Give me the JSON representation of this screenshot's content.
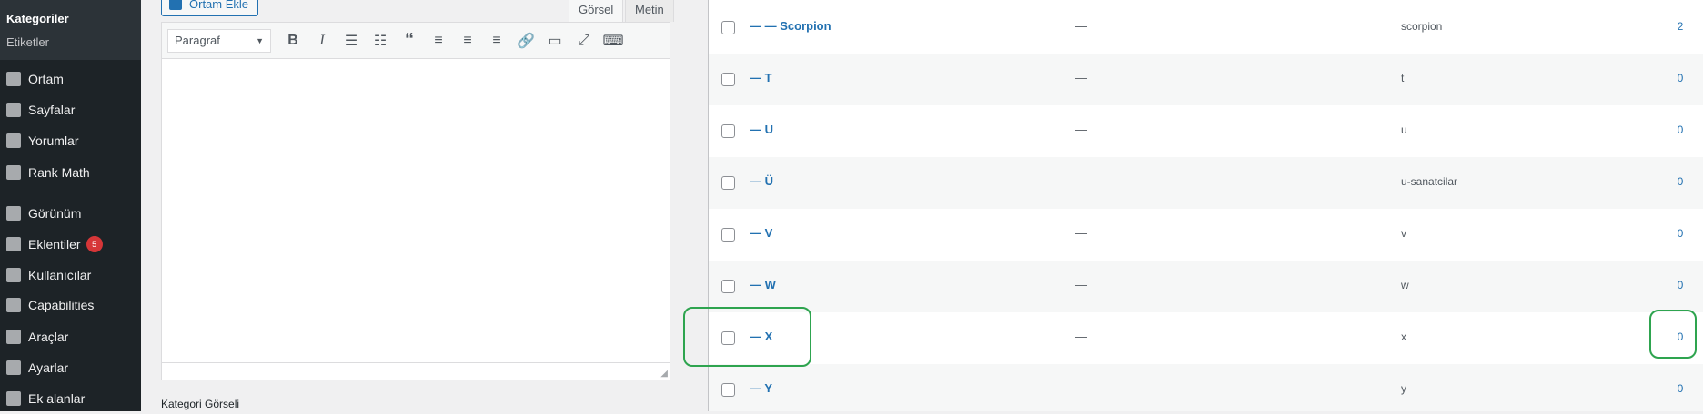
{
  "sidebar": {
    "submenu": [
      "Kategoriler",
      "Etiketler"
    ],
    "items": [
      {
        "label": "Ortam",
        "icon": "media-icon"
      },
      {
        "label": "Sayfalar",
        "icon": "pages-icon"
      },
      {
        "label": "Yorumlar",
        "icon": "comments-icon"
      },
      {
        "label": "Rank Math",
        "icon": "rank-math-icon"
      },
      {
        "label": "Görünüm",
        "icon": "appearance-icon"
      },
      {
        "label": "Eklentiler",
        "icon": "plugins-icon",
        "badge": "5"
      },
      {
        "label": "Kullanıcılar",
        "icon": "users-icon"
      },
      {
        "label": "Capabilities",
        "icon": "key-icon"
      },
      {
        "label": "Araçlar",
        "icon": "tools-icon"
      },
      {
        "label": "Ayarlar",
        "icon": "settings-icon"
      },
      {
        "label": "Ek alanlar",
        "icon": "fields-icon"
      }
    ]
  },
  "editor": {
    "add_media": "Ortam Ekle",
    "tab_visual": "Görsel",
    "tab_text": "Metin",
    "format": "Paragraf",
    "toolbar_icons": [
      "bold-icon",
      "italic-icon",
      "bullet-list-icon",
      "numbered-list-icon",
      "blockquote-icon",
      "align-left-icon",
      "align-center-icon",
      "align-right-icon",
      "link-icon",
      "read-more-icon",
      "fullscreen-icon",
      "toolbar-toggle-icon"
    ],
    "field_label": "Kategori Görseli"
  },
  "table": {
    "rows": [
      {
        "name": "— — Scorpion",
        "desc": "—",
        "slug": "scorpion",
        "count": "2"
      },
      {
        "name": "— T",
        "desc": "—",
        "slug": "t",
        "count": "0"
      },
      {
        "name": "— U",
        "desc": "—",
        "slug": "u",
        "count": "0"
      },
      {
        "name": "— Ü",
        "desc": "—",
        "slug": "u-sanatcilar",
        "count": "0"
      },
      {
        "name": "— V",
        "desc": "—",
        "slug": "v",
        "count": "0"
      },
      {
        "name": "— W",
        "desc": "—",
        "slug": "w",
        "count": "0"
      },
      {
        "name": "— X",
        "desc": "—",
        "slug": "x",
        "count": "0"
      },
      {
        "name": "— Y",
        "desc": "—",
        "slug": "y",
        "count": "0"
      }
    ]
  },
  "colors": {
    "link": "#2271b1",
    "sidebar": "#1d2327",
    "highlight": "#2ea44f"
  }
}
